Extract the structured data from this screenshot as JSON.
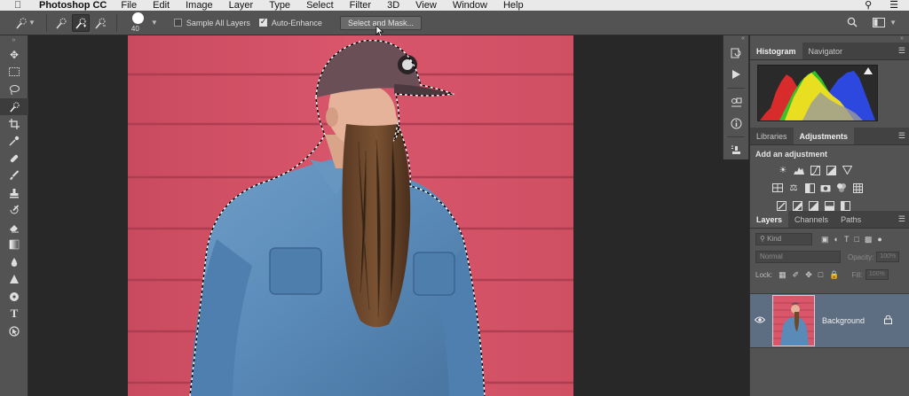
{
  "menubar": {
    "app_name": "Photoshop CC",
    "items": [
      "File",
      "Edit",
      "Image",
      "Layer",
      "Type",
      "Select",
      "Filter",
      "3D",
      "View",
      "Window",
      "Help"
    ]
  },
  "options": {
    "brush_size": "40",
    "sample_all_layers_label": "Sample All Layers",
    "sample_all_layers_checked": false,
    "auto_enhance_label": "Auto-Enhance",
    "auto_enhance_checked": true,
    "select_mask_label": "Select and Mask..."
  },
  "panels": {
    "histogram_tab": "Histogram",
    "navigator_tab": "Navigator",
    "libraries_tab": "Libraries",
    "adjustments_tab": "Adjustments",
    "add_adjustment_label": "Add an adjustment",
    "layers_tab": "Layers",
    "channels_tab": "Channels",
    "paths_tab": "Paths"
  },
  "layers": {
    "kind_placeholder": "Kind",
    "blend_mode": "Normal",
    "opacity_label": "Opacity:",
    "opacity_value": "100%",
    "lock_label": "Lock:",
    "fill_label": "Fill:",
    "fill_value": "100%",
    "layer_name": "Background"
  },
  "colors": {
    "wall": "#d9566b",
    "selected_layer": "#5d6d82",
    "panel": "#535353"
  }
}
